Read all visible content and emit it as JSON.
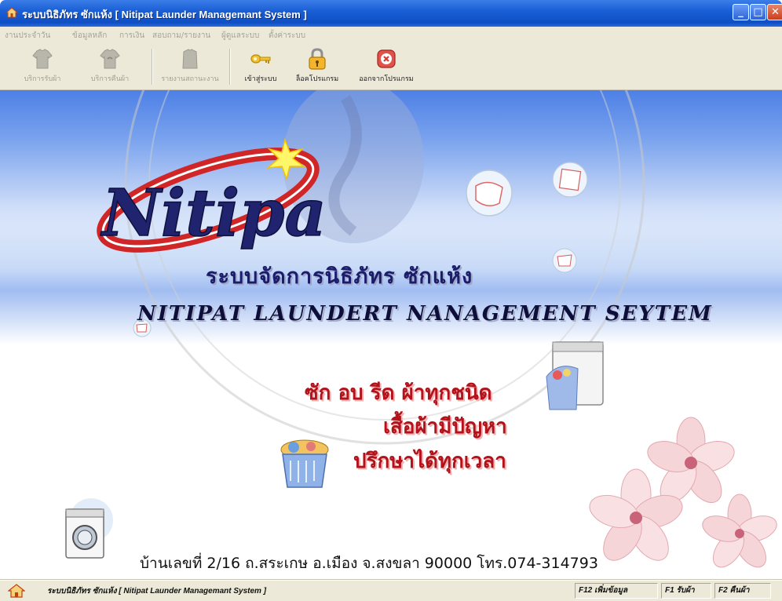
{
  "window": {
    "title": "ระบบนิธิภัทร ซักแห้ง [ Nitipat Launder Managemant System ]",
    "controls": {
      "minimize": "_",
      "maximize": "□",
      "close": "✕"
    }
  },
  "menu": [
    "งานประจำวัน",
    "ข้อมูลหลัก",
    "การเงิน",
    "สอบถาม/รายงาน",
    "ผู้ดูแลระบบ",
    "ตั้งค่าระบบ"
  ],
  "toolbar": {
    "items": [
      {
        "label": "บริการรับผ้า",
        "icon": "shirt-icon",
        "enabled": false
      },
      {
        "label": "บริการคืนผ้า",
        "icon": "shirt-return-icon",
        "enabled": false
      },
      {
        "label": "รายงานสถานะงาน",
        "icon": "report-icon",
        "enabled": false
      },
      {
        "label": "เข้าสู่ระบบ",
        "icon": "key-icon",
        "enabled": true
      },
      {
        "label": "ล็อคโปรแกรม",
        "icon": "lock-icon",
        "enabled": true
      },
      {
        "label": "ออกจากโปรแกรม",
        "icon": "exit-icon",
        "enabled": true
      }
    ]
  },
  "splash": {
    "logo_text": "Nitipat",
    "title_th": "ระบบจัดการนิธิภัทร ซักแห้ง",
    "title_en": "NITIPAT LAUNDERT NANAGEMENT SEYTEM",
    "slogan": [
      "ซัก อบ รีด ผ้าทุกชนิด",
      "เสื้อผ้ามีปัญหา",
      "ปรึกษาได้ทุกเวลา"
    ],
    "address": "บ้านเลขที่ 2/16 ถ.สระเกษ อ.เมือง จ.สงขลา 90000 โทร.074-314793"
  },
  "statusbar": {
    "text": "ระบบนิธิภัทร ซักแห้ง [ Nitipat Launder Managemant System ]",
    "panels": [
      "F12 เพิ่มข้อมูล",
      "F1 รับผ้า",
      "F2 คืนผ้า"
    ]
  },
  "colors": {
    "titlebar": "#1a5fd6",
    "chrome": "#ece9d8",
    "title_text": "#1b1d6b",
    "slogan_text": "#b3121b"
  }
}
